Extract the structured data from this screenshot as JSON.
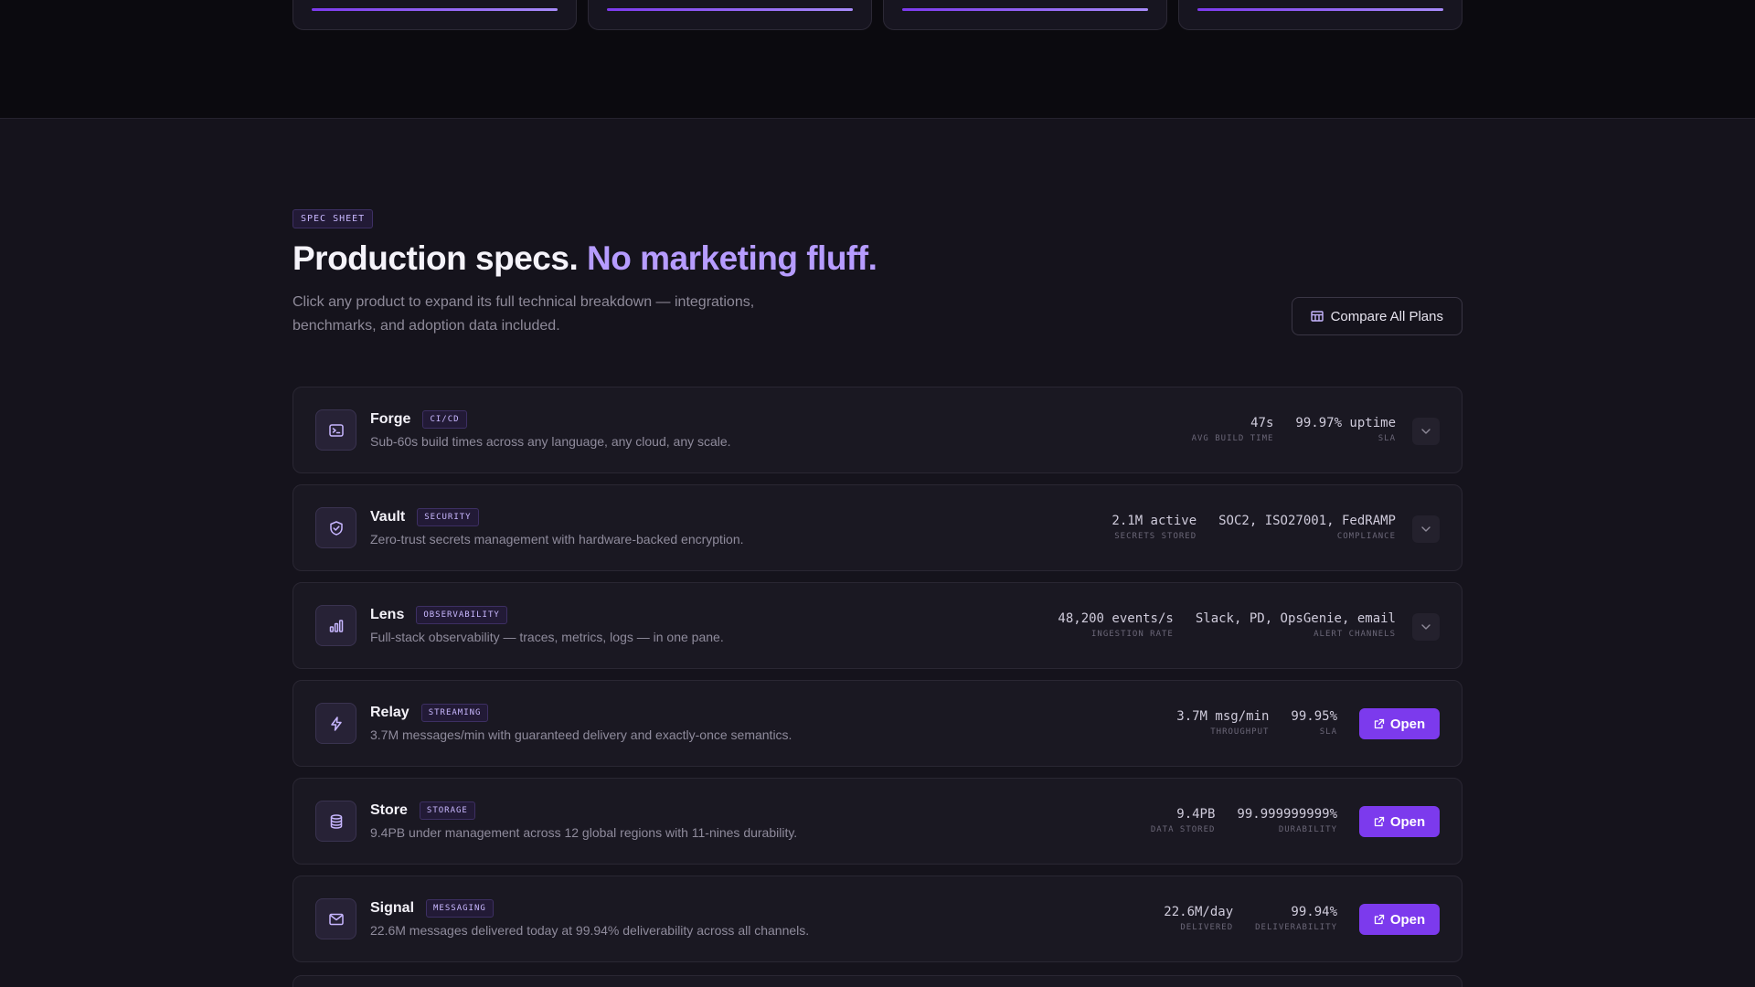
{
  "section": {
    "eyebrow": "SPEC SHEET",
    "headline": "Production specs.",
    "headline_accent": "No marketing fluff.",
    "subtitle": "Click any product to expand its full technical breakdown — integrations, benchmarks, and adoption data included.",
    "compare_label": "Compare All Plans"
  },
  "products": [
    {
      "name": "Forge",
      "tag": "CI/CD",
      "icon": "terminal-icon",
      "desc": "Sub-60s build times across any language, any cloud, any scale.",
      "metrics": [
        {
          "value": "47s",
          "label": "AVG BUILD TIME"
        },
        {
          "value": "99.97% uptime",
          "label": "SLA"
        }
      ],
      "action": "expand"
    },
    {
      "name": "Vault",
      "tag": "SECURITY",
      "icon": "shield-check-icon",
      "desc": "Zero-trust secrets management with hardware-backed encryption.",
      "metrics": [
        {
          "value": "2.1M active",
          "label": "SECRETS STORED"
        },
        {
          "value": "SOC2, ISO27001, FedRAMP",
          "label": "COMPLIANCE"
        }
      ],
      "action": "expand"
    },
    {
      "name": "Lens",
      "tag": "OBSERVABILITY",
      "icon": "bar-chart-icon",
      "desc": "Full-stack observability — traces, metrics, logs — in one pane.",
      "metrics": [
        {
          "value": "48,200 events/s",
          "label": "INGESTION RATE"
        },
        {
          "value": "Slack, PD, OpsGenie, email",
          "label": "ALERT CHANNELS"
        }
      ],
      "action": "expand"
    },
    {
      "name": "Relay",
      "tag": "STREAMING",
      "icon": "lightning-icon",
      "desc": "3.7M messages/min with guaranteed delivery and exactly-once semantics.",
      "metrics": [
        {
          "value": "3.7M msg/min",
          "label": "THROUGHPUT"
        },
        {
          "value": "99.95%",
          "label": "SLA"
        }
      ],
      "action": "open",
      "action_label": "Open"
    },
    {
      "name": "Store",
      "tag": "STORAGE",
      "icon": "database-icon",
      "desc": "9.4PB under management across 12 global regions with 11-nines durability.",
      "metrics": [
        {
          "value": "9.4PB",
          "label": "DATA STORED"
        },
        {
          "value": "99.999999999%",
          "label": "DURABILITY"
        }
      ],
      "action": "open",
      "action_label": "Open"
    },
    {
      "name": "Signal",
      "tag": "MESSAGING",
      "icon": "mail-icon",
      "desc": "22.6M messages delivered today at 99.94% deliverability across all channels.",
      "metrics": [
        {
          "value": "22.6M/day",
          "label": "DELIVERED"
        },
        {
          "value": "99.94%",
          "label": "DELIVERABILITY"
        }
      ],
      "action": "open",
      "action_label": "Open"
    }
  ],
  "colors": {
    "accent": "#7c3aed",
    "accent_light": "#b69cff",
    "background": "#15131c"
  }
}
